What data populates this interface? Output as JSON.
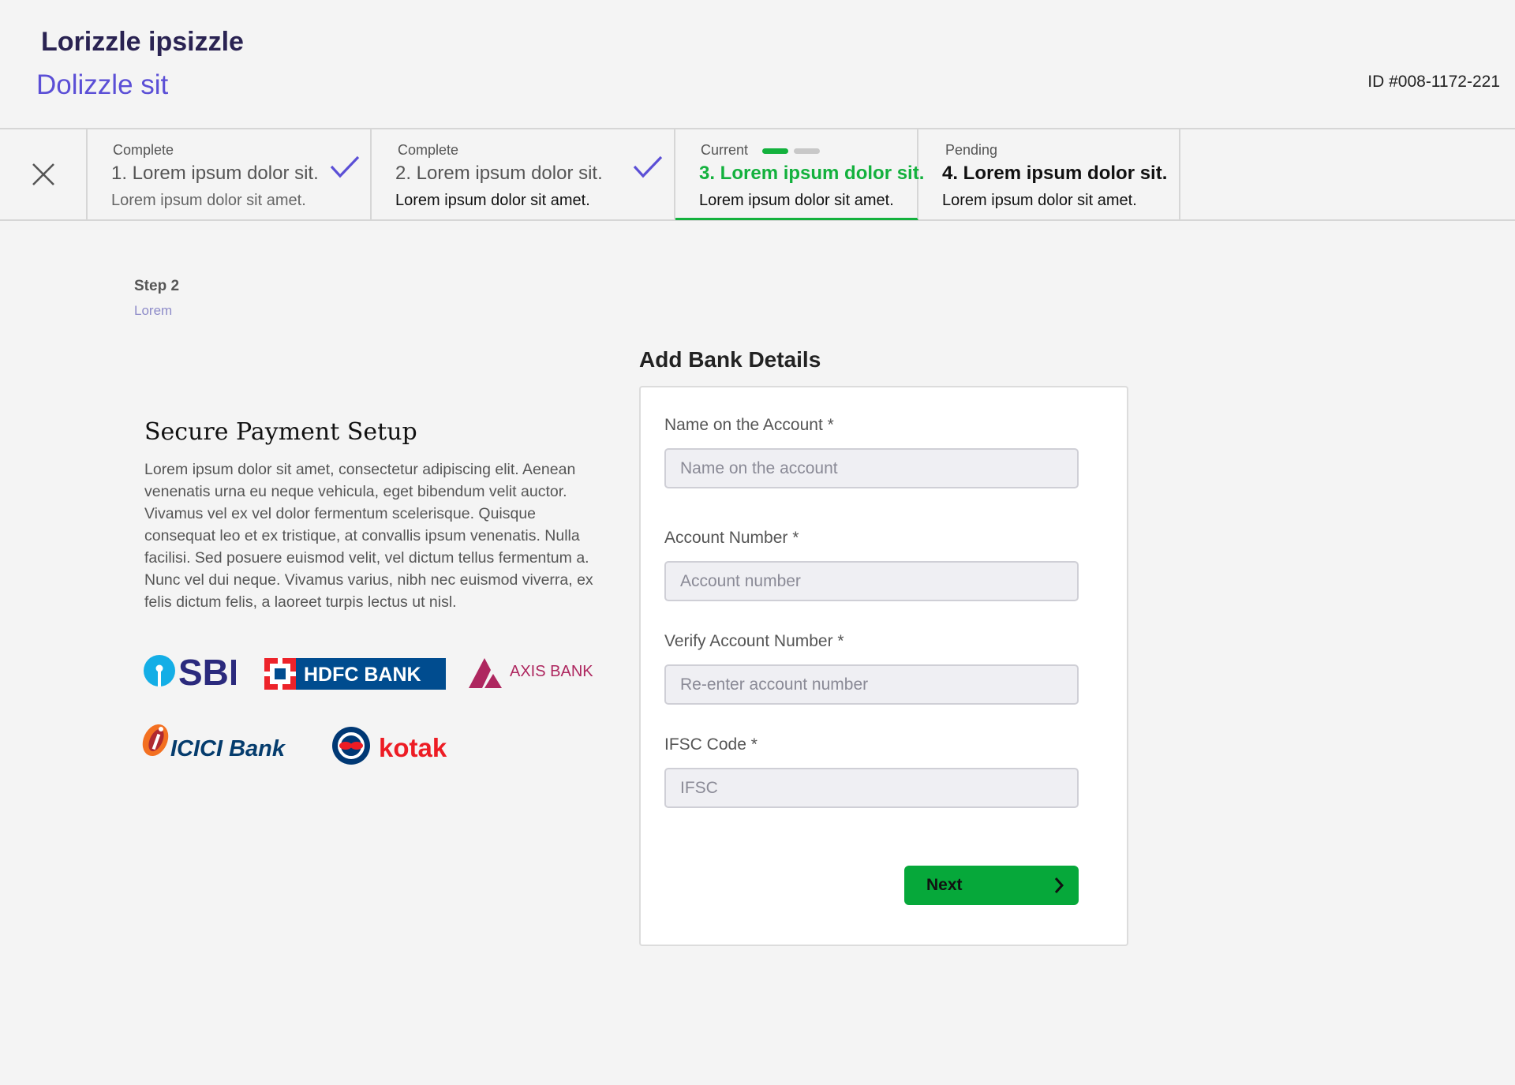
{
  "header": {
    "title": "Lorizzle ipsizzle",
    "subtitle": "Dolizzle sit",
    "case_id": "ID #008-1172-221"
  },
  "stepper": {
    "close_icon": "close-icon",
    "steps": [
      {
        "status": "Complete",
        "title": "1. Lorem ipsum dolor sit.",
        "description": "Lorem ipsum dolor sit amet.",
        "state": "complete"
      },
      {
        "status": "Complete",
        "title": "2. Lorem ipsum dolor sit.",
        "description": "Lorem ipsum dolor sit amet.",
        "state": "complete"
      },
      {
        "status": "Current",
        "title": "3. Lorem ipsum dolor sit.",
        "description": "Lorem ipsum dolor sit amet.",
        "state": "current",
        "progress": 0.5
      },
      {
        "status": "Pending",
        "title": "4. Lorem ipsum dolor sit.",
        "description": "Lorem ipsum dolor sit amet.",
        "state": "pending"
      }
    ]
  },
  "section": {
    "step_label": "Step 2",
    "step_sub": "Lorem"
  },
  "info": {
    "title": "Secure Payment Setup",
    "body": "Lorem ipsum dolor sit amet, consectetur adipiscing elit. Aenean venenatis urna eu neque vehicula, eget bibendum velit auctor. Vivamus vel ex vel dolor fermentum scelerisque. Quisque consequat leo et ex tristique, at convallis ipsum venenatis. Nulla facilisi. Sed posuere euismod velit, vel dictum tellus fermentum a. Nunc vel dui neque. Vivamus varius, nibh nec euismod viverra, ex felis dictum felis, a laoreet turpis lectus ut nisl."
  },
  "banks": {
    "sbi": "SBI",
    "hdfc": "HDFC BANK",
    "axis": "AXIS BANK",
    "icici": "ICICI Bank",
    "kotak": "kotak"
  },
  "form": {
    "title": "Add Bank Details",
    "fields": [
      {
        "label": "Name on the Account *",
        "placeholder": "Name on the account",
        "value": ""
      },
      {
        "label": "Account Number *",
        "placeholder": "Account number",
        "value": ""
      },
      {
        "label": "Verify Account Number *",
        "placeholder": "Re-enter account number",
        "value": ""
      },
      {
        "label": "IFSC Code *",
        "placeholder": "IFSC",
        "value": ""
      }
    ],
    "next_label": "Next"
  },
  "colors": {
    "brand_dark": "#2a2352",
    "brand_accent": "#5b4fd6",
    "success": "#13b13d",
    "next_button": "#06a83a",
    "check": "#5b4fd6"
  }
}
